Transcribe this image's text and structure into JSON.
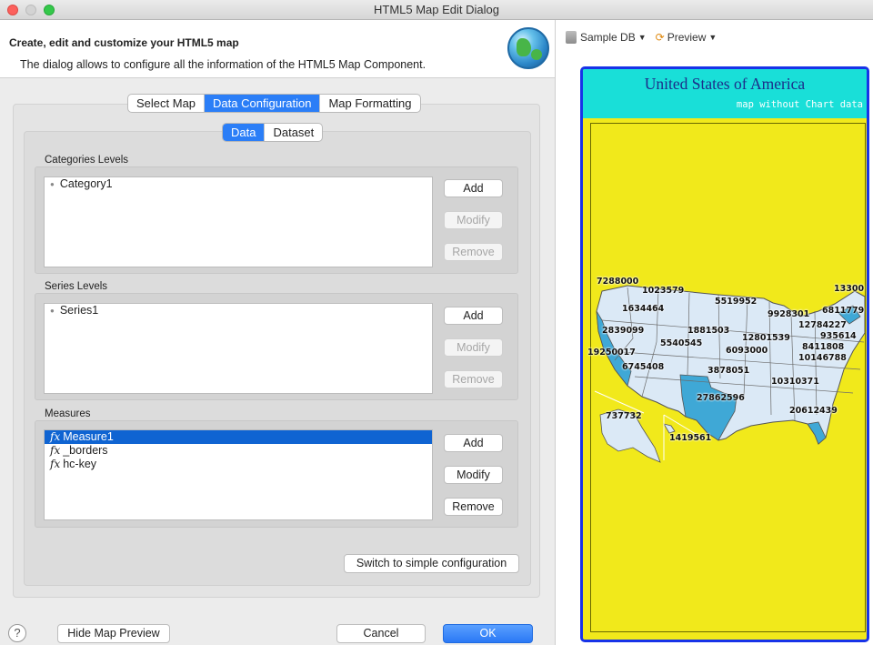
{
  "window": {
    "title": "HTML5 Map Edit Dialog"
  },
  "dialog": {
    "heading": "Create, edit and customize your HTML5 map",
    "description": "The dialog allows to configure all the information of the HTML5 Map Component."
  },
  "tabs": {
    "main": [
      {
        "label": "Select Map",
        "active": false
      },
      {
        "label": "Data Configuration",
        "active": true
      },
      {
        "label": "Map Formatting",
        "active": false
      }
    ],
    "sub": [
      {
        "label": "Data",
        "active": true
      },
      {
        "label": "Dataset",
        "active": false
      }
    ]
  },
  "categories": {
    "label": "Categories Levels",
    "items": [
      "Category1"
    ],
    "buttons": {
      "add": "Add",
      "modify": "Modify",
      "remove": "Remove"
    }
  },
  "series": {
    "label": "Series Levels",
    "items": [
      "Series1"
    ],
    "buttons": {
      "add": "Add",
      "modify": "Modify",
      "remove": "Remove"
    }
  },
  "measures": {
    "label": "Measures",
    "fx_symbol": "fx",
    "items": [
      "Measure1",
      "_borders",
      "hc-key"
    ],
    "selected_index": 0,
    "buttons": {
      "add": "Add",
      "modify": "Modify",
      "remove": "Remove"
    }
  },
  "switch_label": "Switch to simple configuration",
  "footer": {
    "help_symbol": "?",
    "hide_preview": "Hide Map Preview",
    "cancel": "Cancel",
    "ok": "OK"
  },
  "preview": {
    "toolbar": {
      "db_label": "Sample DB",
      "preview_label": "Preview"
    },
    "map_title": "United States of America",
    "map_subtitle": "map without Chart data",
    "value_labels": [
      "7288000",
      "1023579",
      "13300",
      "5519952",
      "1634464",
      "9928301",
      "6811779",
      "2839099",
      "1881503",
      "12784227",
      "12801539",
      "935614",
      "5540545",
      "8411808",
      "6093000",
      "19250017",
      "10146788",
      "6745408",
      "3878051",
      "10310371",
      "27862596",
      "20612439",
      "737732",
      "1419561"
    ],
    "colors": {
      "frame_border": "#1733e8",
      "title_bg": "#19dfd8",
      "map_bg": "#f1e91b",
      "state_fill": "#dbe9f6",
      "highlight_fill": "#3fa8d6",
      "accent_button": "#2b7ef7"
    }
  }
}
